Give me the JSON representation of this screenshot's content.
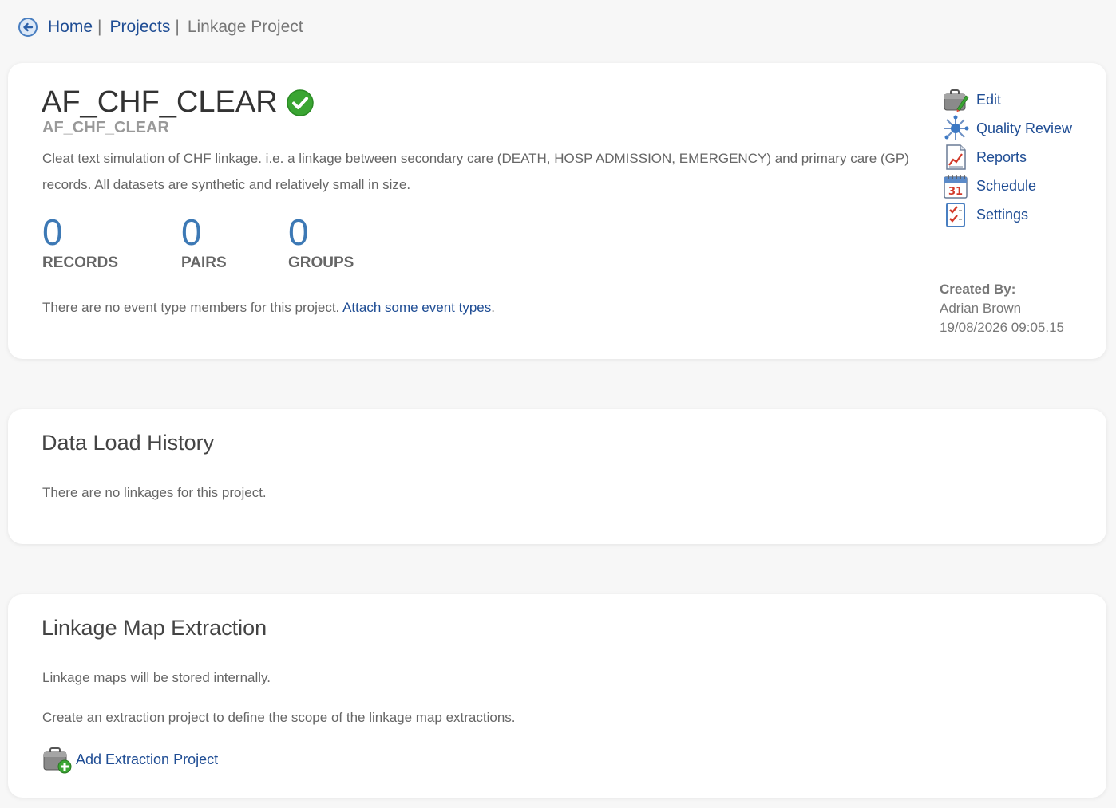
{
  "breadcrumb": {
    "home": "Home",
    "projects": "Projects",
    "separator": "|",
    "current": "Linkage Project"
  },
  "project": {
    "title": "AF_CHF_CLEAR",
    "subtitle": "AF_CHF_CLEAR",
    "description": "Cleat text simulation of CHF linkage. i.e. a linkage between secondary care (DEATH, HOSP ADMISSION, EMERGENCY) and primary care (GP) records. All datasets are synthetic and relatively small in size.",
    "status_icon": "check-circle-icon",
    "stats": {
      "records": {
        "value": "0",
        "label": "RECORDS"
      },
      "pairs": {
        "value": "0",
        "label": "PAIRS"
      },
      "groups": {
        "value": "0",
        "label": "GROUPS"
      }
    },
    "events_text": "There are no event type members for this project.",
    "events_link": "Attach some event types",
    "events_end": ".",
    "actions": [
      {
        "label": "Edit",
        "icon": "briefcase-edit-icon"
      },
      {
        "label": "Quality Review",
        "icon": "quality-review-icon"
      },
      {
        "label": "Reports",
        "icon": "report-chart-icon"
      },
      {
        "label": "Schedule",
        "icon": "calendar-icon"
      },
      {
        "label": "Settings",
        "icon": "checklist-icon"
      }
    ],
    "created_by_label": "Created By:",
    "created_by_name": "Adrian Brown",
    "created_at": "19/08/2026 09:05.15"
  },
  "history": {
    "title": "Data Load History",
    "empty_text": "There are no linkages for this project."
  },
  "extraction": {
    "title": "Linkage Map Extraction",
    "line1": "Linkage maps will be stored internally.",
    "line2": "Create an extraction project to define the scope of the linkage map extractions.",
    "add_label": "Add Extraction Project"
  },
  "colors": {
    "link": "#1f4d94",
    "stat_number": "#3d79b5",
    "success": "#3aa532"
  }
}
